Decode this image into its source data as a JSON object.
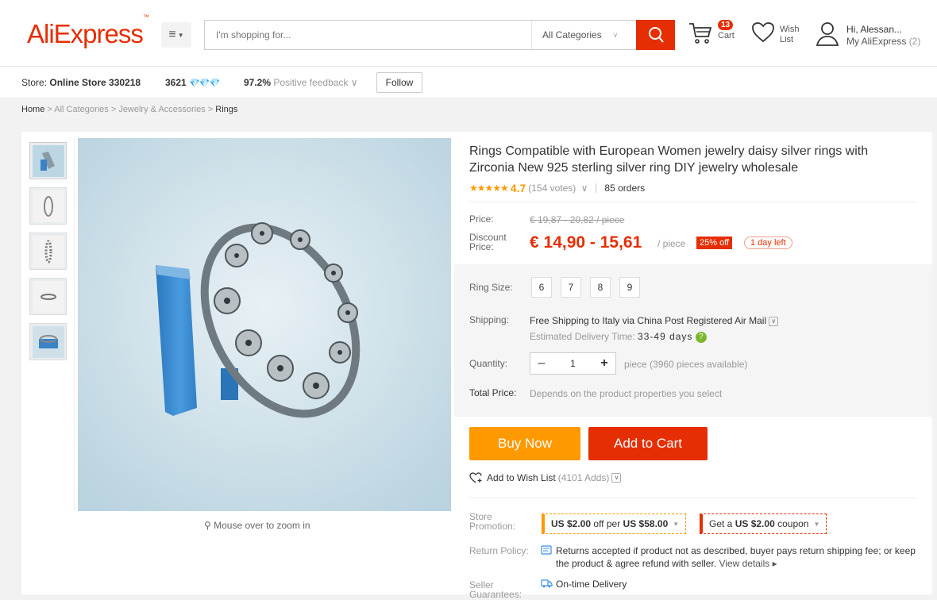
{
  "header": {
    "logo": "AliExpress",
    "logo_tm": "™",
    "search_placeholder": "I'm shopping for...",
    "category": "All Categories",
    "cart_count": "13",
    "cart_label": "Cart",
    "wish_label_1": "Wish",
    "wish_label_2": "List",
    "user_greeting": "Hi, Alessan...",
    "user_link": "My AliExpress",
    "user_count": "(2)"
  },
  "store": {
    "label": "Store:",
    "name": "Online Store 330218",
    "score": "3621",
    "feedback_pct": "97.2%",
    "feedback_label": "Positive feedback",
    "follow": "Follow"
  },
  "breadcrumb": [
    "Home",
    "All Categories",
    "Jewelry & Accessories",
    "Rings"
  ],
  "gallery": {
    "zoom_hint": "Mouse over to zoom in"
  },
  "product": {
    "title": "Rings Compatible with European Women jewelry daisy silver rings with Zirconia New 925 sterling silver ring DIY jewelry wholesale",
    "rating": "4.7",
    "votes": "(154 votes)",
    "orders": "85 orders",
    "price_label": "Price:",
    "old_price": "€ 19,87 - 20,82 / piece",
    "discount_label_1": "Discount",
    "discount_label_2": "Price:",
    "new_price": "€ 14,90 - 15,61",
    "per_piece": "/ piece",
    "off": "25% off",
    "days_left": "1 day left",
    "ring_size_label": "Ring Size:",
    "ring_sizes": [
      "6",
      "7",
      "8",
      "9"
    ],
    "shipping_label": "Shipping:",
    "shipping_text": "Free Shipping to Italy via China Post Registered Air Mail",
    "delivery_label": "Estimated Delivery Time:",
    "delivery_days": "33-49 days",
    "quantity_label": "Quantity:",
    "quantity": "1",
    "quantity_note": "piece (3960 pieces available)",
    "total_label": "Total Price:",
    "total_note": "Depends on the product properties you select",
    "buy_now": "Buy Now",
    "add_to_cart": "Add to Cart",
    "wishlist": "Add to Wish List",
    "wishlist_adds": "(4101 Adds)",
    "promo_label_1": "Store",
    "promo_label_2": "Promotion:",
    "promo1_amount": "US $2.00",
    "promo1_mid": "off per",
    "promo1_min": "US $58.00",
    "promo2_pre": "Get a",
    "promo2_amount": "US $2.00",
    "promo2_post": "coupon",
    "return_label": "Return Policy:",
    "return_text": "Returns accepted if product not as described, buyer pays return shipping fee; or keep the product & agree refund with seller.",
    "return_link": "View details",
    "seller_label_1": "Seller",
    "seller_label_2": "Guarantees:",
    "guarantee": "On-time Delivery"
  },
  "colors": {
    "brand": "#e62e04",
    "orange": "#ff9900",
    "gem": "#3a8ee6"
  }
}
